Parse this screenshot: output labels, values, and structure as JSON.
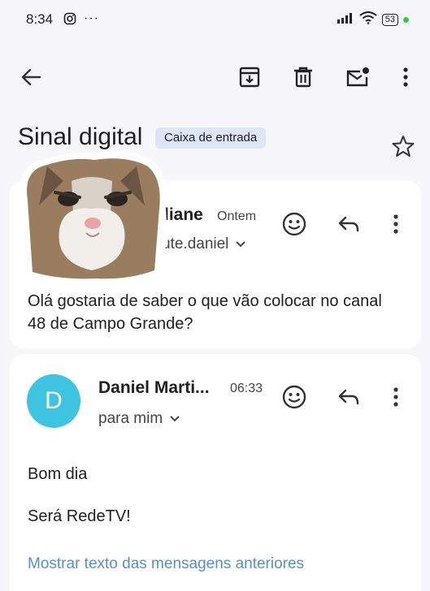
{
  "status_bar": {
    "time": "8:34",
    "notification_icons": [
      "instagram-icon",
      "more-icon"
    ],
    "battery": "53"
  },
  "toolbar": {
    "icons": [
      "back-arrow-icon",
      "archive-icon",
      "delete-icon",
      "mark-unread-icon",
      "more-vert-icon"
    ]
  },
  "thread": {
    "subject": "Sinal digital",
    "label": "Caixa de entrada"
  },
  "message1": {
    "sender_partial": "liane",
    "time": "Ontem",
    "recipient_partial": "ute.daniel",
    "body": "Olá gostaria de saber o que vão colocar no canal 48 de Campo Grande?"
  },
  "message2": {
    "avatar_letter": "D",
    "avatar_color": "#3ec4e0",
    "sender": "Daniel Marti...",
    "time": "06:33",
    "recipient": "para mim",
    "greeting": "Bom dia",
    "body": "Será RedeTV!",
    "show_quoted": "Mostrar texto das mensagens anteriores"
  },
  "colors": {
    "accent_chip": "#dde5fb",
    "link": "#5a8fc6",
    "background": "#f6f6fb"
  }
}
